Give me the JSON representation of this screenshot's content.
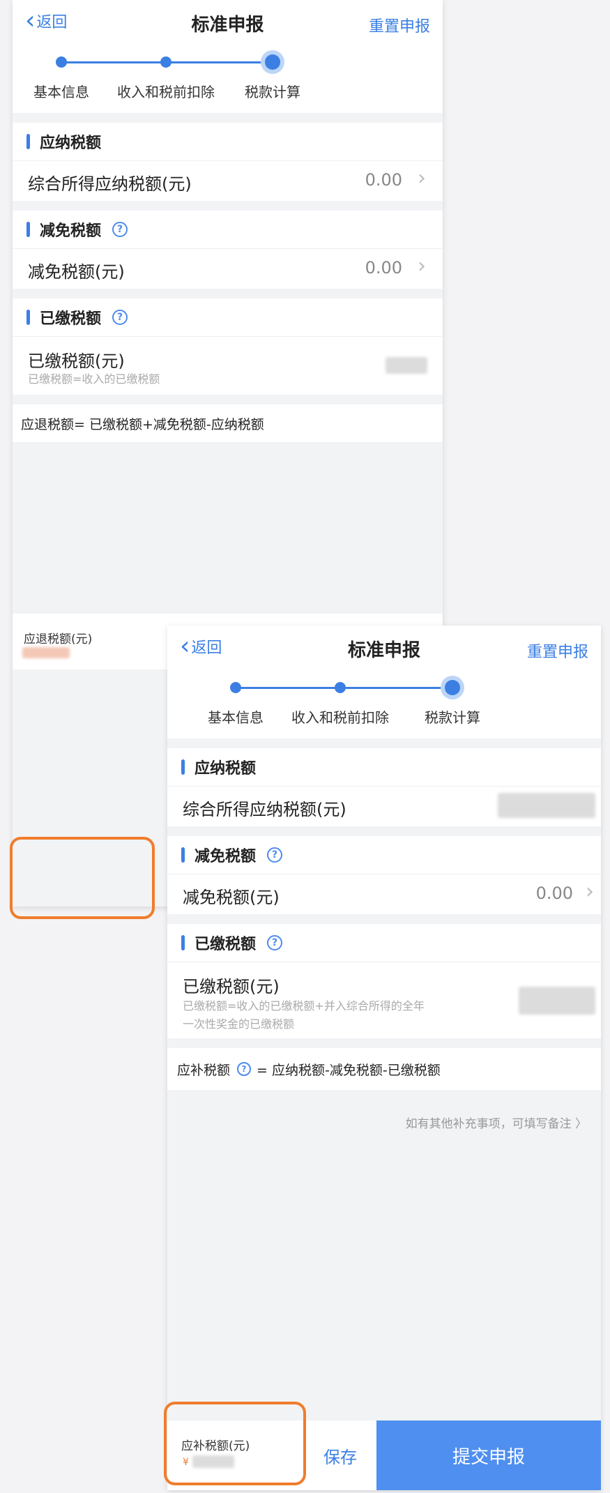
{
  "screen1": {
    "nav": {
      "back": "返回",
      "title": "标准申报",
      "reset": "重置申报"
    },
    "steps": [
      "基本信息",
      "收入和税前扣除",
      "税款计算"
    ],
    "sections": {
      "payable": {
        "title": "应纳税额",
        "row_label": "综合所得应纳税额(元)",
        "row_value": "0.00"
      },
      "reduce": {
        "title": "减免税额",
        "row_label": "减免税额(元)",
        "row_value": "0.00"
      },
      "paid": {
        "title": "已缴税额",
        "row_label": "已缴税额(元)",
        "row_sub": "已缴税额=收入的已缴税额"
      }
    },
    "formula": "应退税额= 已缴税额+减免税额-应纳税额",
    "bottom_label": "应退税额(元)"
  },
  "screen2": {
    "nav": {
      "back": "返回",
      "title": "标准申报",
      "reset": "重置申报"
    },
    "steps": [
      "基本信息",
      "收入和税前扣除",
      "税款计算"
    ],
    "sections": {
      "payable": {
        "title": "应纳税额",
        "row_label": "综合所得应纳税额(元)"
      },
      "reduce": {
        "title": "减免税额",
        "row_label": "减免税额(元)",
        "row_value": "0.00"
      },
      "paid": {
        "title": "已缴税额",
        "row_label": "已缴税额(元)",
        "row_sub1": "已缴税额=收入的已缴税额+并入综合所得的全年",
        "row_sub2": "一次性奖金的已缴税额"
      }
    },
    "formula_label": "应补税额",
    "formula_rest": "= 应纳税额-减免税额-已缴税额",
    "note": "如有其他补充事项，可填写备注",
    "note_arrow": "〉",
    "bottom_label": "应补税额(元)",
    "bottom_currency": "¥",
    "save": "保存",
    "submit": "提交申报"
  },
  "icons": {
    "help": "?",
    "chevron_right": "›",
    "chevron_left": "‹"
  },
  "colors": {
    "accent": "#3b7fe3",
    "highlight": "#ef7d2c",
    "submit_bg": "#4f8ff0"
  }
}
